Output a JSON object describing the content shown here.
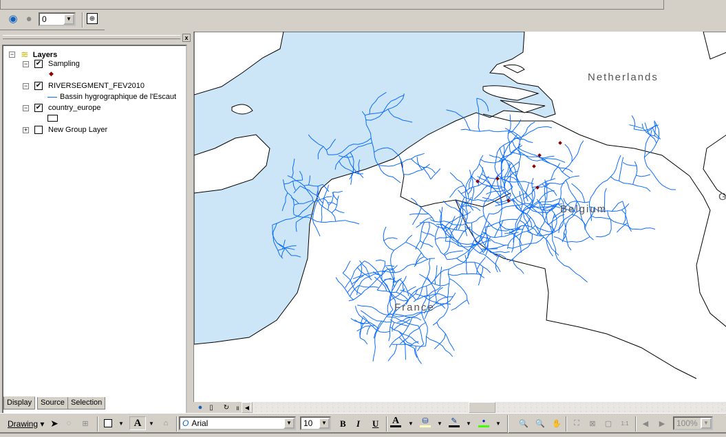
{
  "toolbar_top": {
    "reference_scale_value": "0"
  },
  "toc": {
    "root": "Layers",
    "layers": [
      {
        "name": "Sampling",
        "checked": true,
        "expanded": true,
        "legend": "point-symbol"
      },
      {
        "name": "RIVERSEGMENT_FEV2010",
        "checked": true,
        "expanded": true,
        "legend": "Bassin hygrographique de l'Escaut"
      },
      {
        "name": "country_europe",
        "checked": true,
        "expanded": true,
        "legend": "polygon-symbol"
      },
      {
        "name": "New Group Layer",
        "checked": false,
        "expanded": false
      }
    ],
    "tabs": [
      "Display",
      "Source",
      "Selection"
    ],
    "active_tab": "Display"
  },
  "map": {
    "labels": {
      "netherlands": "Netherlands",
      "belgium": "Belgium",
      "france": "France",
      "germany_partial": "G"
    },
    "colors": {
      "sea": "#cce6f8",
      "river": "#0a6cff",
      "point": "#8b0000",
      "border": "#000000"
    }
  },
  "drawing_toolbar": {
    "drawing_label": "Drawing",
    "font": "Arial",
    "font_size": "10",
    "bold": "B",
    "italic": "I",
    "underline": "U",
    "zoom": "100%",
    "colors": {
      "font": "#000000",
      "fill": "#ffffc0",
      "line": "#000000",
      "marker": "#40ff00"
    }
  }
}
